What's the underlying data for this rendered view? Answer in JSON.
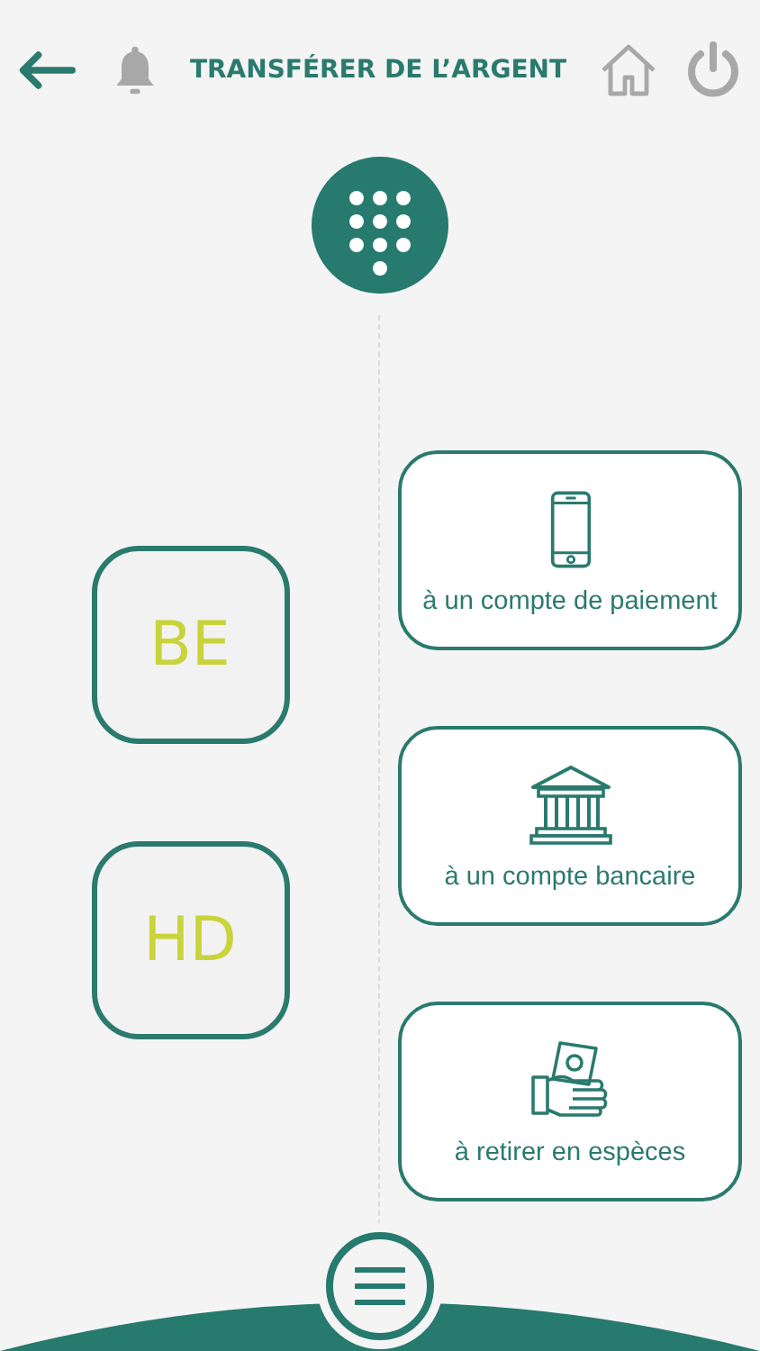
{
  "header": {
    "title": "TRANSFÉRER DE L’ARGENT"
  },
  "contacts": [
    {
      "initials": "BE"
    },
    {
      "initials": "HD"
    }
  ],
  "options": [
    {
      "kind": "phone",
      "label": "à un compte de paiement"
    },
    {
      "kind": "bank",
      "label": "à un compte bancaire"
    },
    {
      "kind": "cash",
      "label": "à retirer en espèces"
    }
  ]
}
